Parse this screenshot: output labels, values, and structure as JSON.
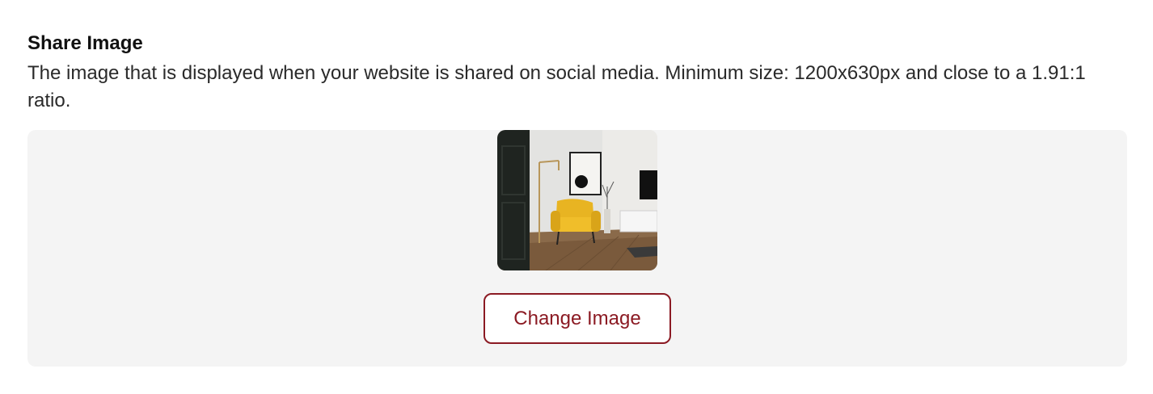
{
  "share_image": {
    "title": "Share Image",
    "description": "The image that is displayed when your website is shared on social media. Minimum size: 1200x630px and close to a 1.91:1 ratio.",
    "change_button_label": "Change Image",
    "preview_subject": "living-room-yellow-armchair"
  },
  "colors": {
    "accent": "#8b1a23",
    "panel_background": "#f4f4f4"
  }
}
